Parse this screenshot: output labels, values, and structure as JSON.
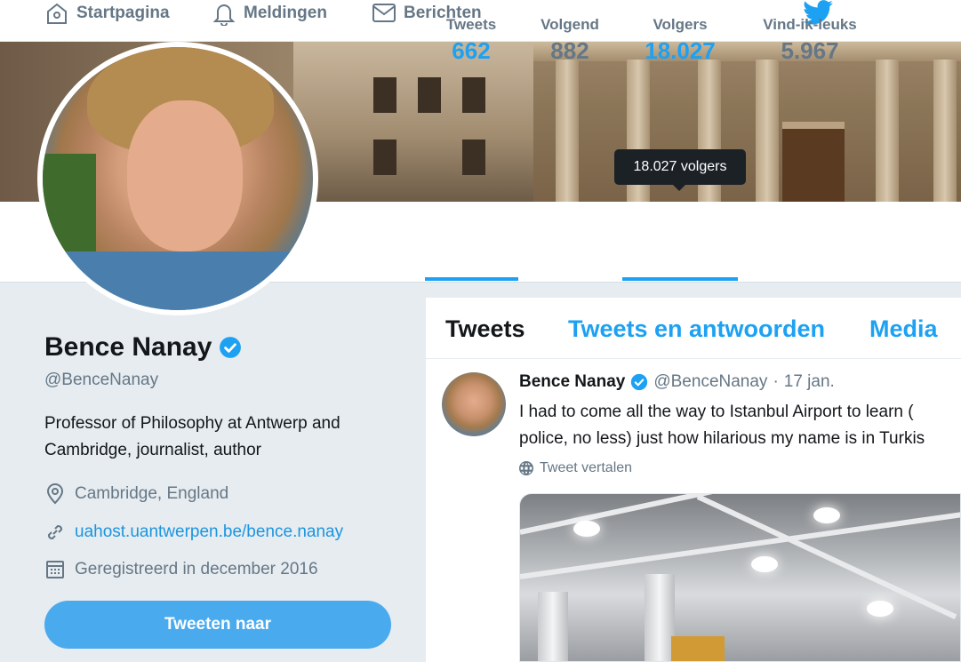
{
  "nav": {
    "home_label": "Startpagina",
    "notifications_label": "Meldingen",
    "messages_label": "Berichten"
  },
  "tooltip": "18.027 volgers",
  "stats": [
    {
      "label": "Tweets",
      "value": "662",
      "active": true
    },
    {
      "label": "Volgend",
      "value": "882",
      "active": false
    },
    {
      "label": "Volgers",
      "value": "18.027",
      "active": true
    },
    {
      "label": "Vind-ik-leuks",
      "value": "5.967",
      "active": false
    }
  ],
  "profile": {
    "name": "Bence Nanay",
    "handle": "@BenceNanay",
    "bio": "Professor of Philosophy at Antwerp and Cambridge, journalist, author",
    "location": "Cambridge, England",
    "url": "uahost.uantwerpen.be/bence.nanay",
    "joined": "Geregistreerd in december 2016",
    "tweet_to_label": "Tweeten naar"
  },
  "timeline": {
    "tabs": [
      "Tweets",
      "Tweets en antwoorden",
      "Media"
    ],
    "tweet": {
      "name": "Bence Nanay",
      "handle": "@BenceNanay",
      "dot": "·",
      "date": "17 jan.",
      "text_line1": "I had to come all the way to Istanbul Airport to learn (",
      "text_line2": "police, no less) just how hilarious my name is in Turkis",
      "translate_label": "Tweet vertalen"
    }
  },
  "colors": {
    "accent": "#1da1f2",
    "muted": "#657786",
    "background": "#e6ecf0"
  }
}
